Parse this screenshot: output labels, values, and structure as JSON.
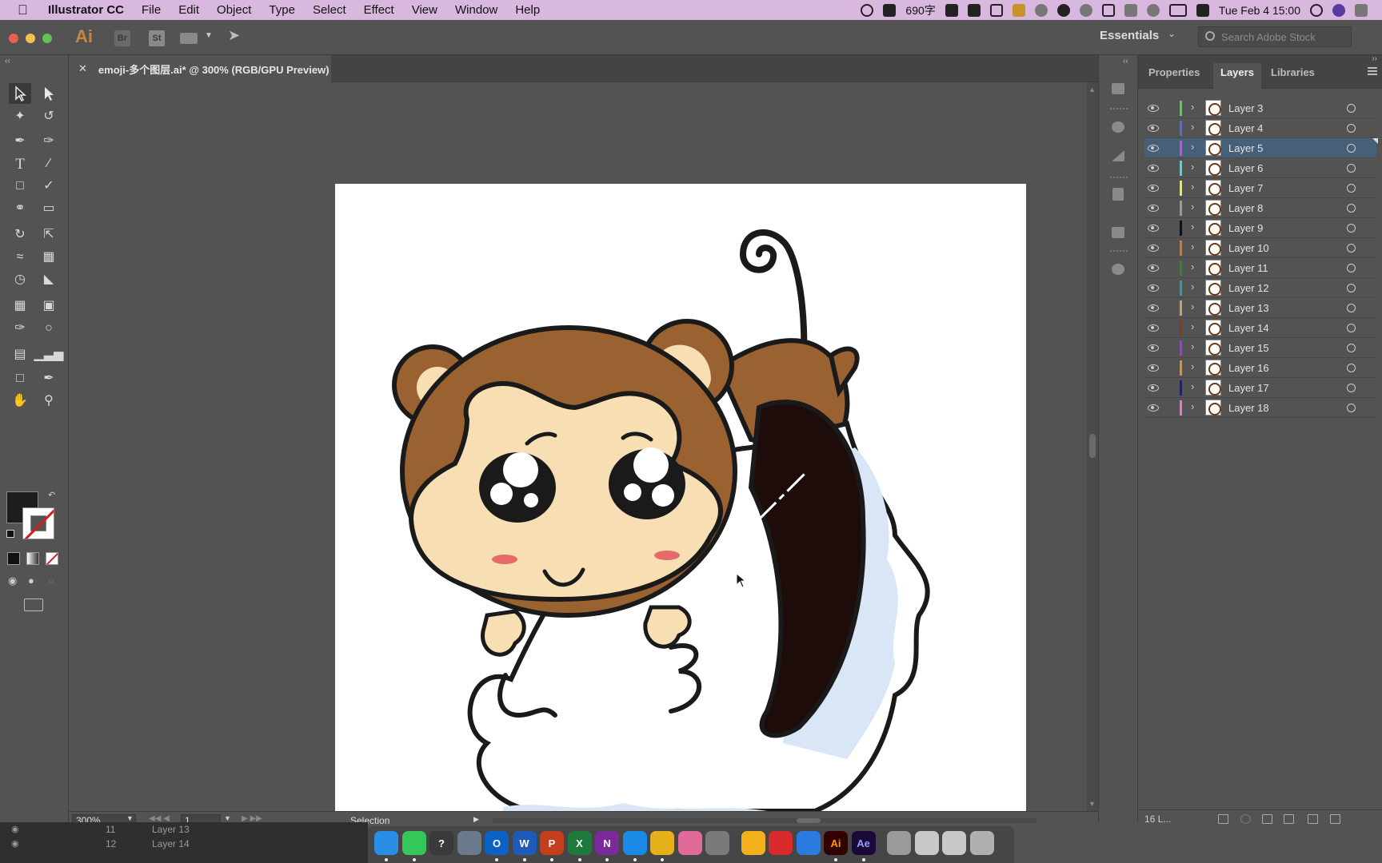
{
  "menubar": {
    "app_name": "Illustrator CC",
    "menus": [
      "File",
      "Edit",
      "Object",
      "Type",
      "Select",
      "Effect",
      "View",
      "Window",
      "Help"
    ],
    "char_count": "690字",
    "datetime": "Tue Feb 4  15:00"
  },
  "appbar": {
    "logo": "Ai",
    "bridge": "Br",
    "stock": "St",
    "workspace": "Essentials",
    "stock_search_placeholder": "Search Adobe Stock"
  },
  "document": {
    "tab_title": "emoji-多个图层.ai* @ 300% (RGB/GPU Preview)"
  },
  "statusbar": {
    "zoom": "300%",
    "artboard": "1",
    "tool": "Selection"
  },
  "panels": {
    "tabs": [
      "Properties",
      "Layers",
      "Libraries"
    ],
    "layers": [
      {
        "name": "Layer 3",
        "color": "#4fd34f"
      },
      {
        "name": "Layer 4",
        "color": "#4f6fe0"
      },
      {
        "name": "Layer 5",
        "color": "#c84fe0"
      },
      {
        "name": "Layer 6",
        "color": "#4fd3e0"
      },
      {
        "name": "Layer 7",
        "color": "#e8e84f"
      },
      {
        "name": "Layer 8",
        "color": "#9a9a9a"
      },
      {
        "name": "Layer 9",
        "color": "#111111"
      },
      {
        "name": "Layer 10",
        "color": "#e0702a"
      },
      {
        "name": "Layer 11",
        "color": "#2a8a2a"
      },
      {
        "name": "Layer 12",
        "color": "#2aa0a0"
      },
      {
        "name": "Layer 13",
        "color": "#c8a070"
      },
      {
        "name": "Layer 14",
        "color": "#8a3a1a"
      },
      {
        "name": "Layer 15",
        "color": "#9a3ae0"
      },
      {
        "name": "Layer 16",
        "color": "#e0902a"
      },
      {
        "name": "Layer 17",
        "color": "#1a1aa0"
      },
      {
        "name": "Layer 18",
        "color": "#e07ac8"
      }
    ],
    "selected_layer": "Layer 5",
    "layer_count": "16 L..."
  },
  "timeline": {
    "rows": [
      {
        "index": "11",
        "name": "Layer 13"
      },
      {
        "index": "12",
        "name": "Layer 14"
      }
    ]
  },
  "dock": {
    "apps": [
      {
        "name": "finder",
        "label": "",
        "color": "#2b8ee6"
      },
      {
        "name": "messages",
        "label": "",
        "color": "#34c759"
      },
      {
        "name": "help",
        "label": "?",
        "color": "#3a3a3a"
      },
      {
        "name": "launchpad",
        "label": "",
        "color": "#6a7a8a"
      },
      {
        "name": "outlook",
        "label": "O",
        "color": "#0b62c4"
      },
      {
        "name": "word",
        "label": "W",
        "color": "#1e5bb8"
      },
      {
        "name": "powerpoint",
        "label": "P",
        "color": "#c43e1c"
      },
      {
        "name": "excel",
        "label": "X",
        "color": "#1e7a3c"
      },
      {
        "name": "onenote",
        "label": "N",
        "color": "#7a2a9a"
      },
      {
        "name": "safari",
        "label": "",
        "color": "#1a8ae6"
      },
      {
        "name": "chrome",
        "label": "",
        "color": "#e6b01a"
      },
      {
        "name": "photos",
        "label": "",
        "color": "#e06a9a"
      },
      {
        "name": "system-preferences",
        "label": "",
        "color": "#7a7a7a"
      },
      {
        "name": "sketch",
        "label": "",
        "color": "#f2b01a"
      },
      {
        "name": "xmind",
        "label": "",
        "color": "#d82a2a"
      },
      {
        "name": "qq-browser",
        "label": "",
        "color": "#2a7ae0"
      },
      {
        "name": "illustrator",
        "label": "Ai",
        "color": "#330000"
      },
      {
        "name": "after-effects",
        "label": "Ae",
        "color": "#1a0a3a"
      },
      {
        "name": "preview",
        "label": "",
        "color": "#9a9a9a"
      },
      {
        "name": "folder-1",
        "label": "",
        "color": "#c8c8c8"
      },
      {
        "name": "folder-2",
        "label": "",
        "color": "#c8c8c8"
      },
      {
        "name": "trash",
        "label": "",
        "color": "#b0b0b0"
      }
    ]
  }
}
